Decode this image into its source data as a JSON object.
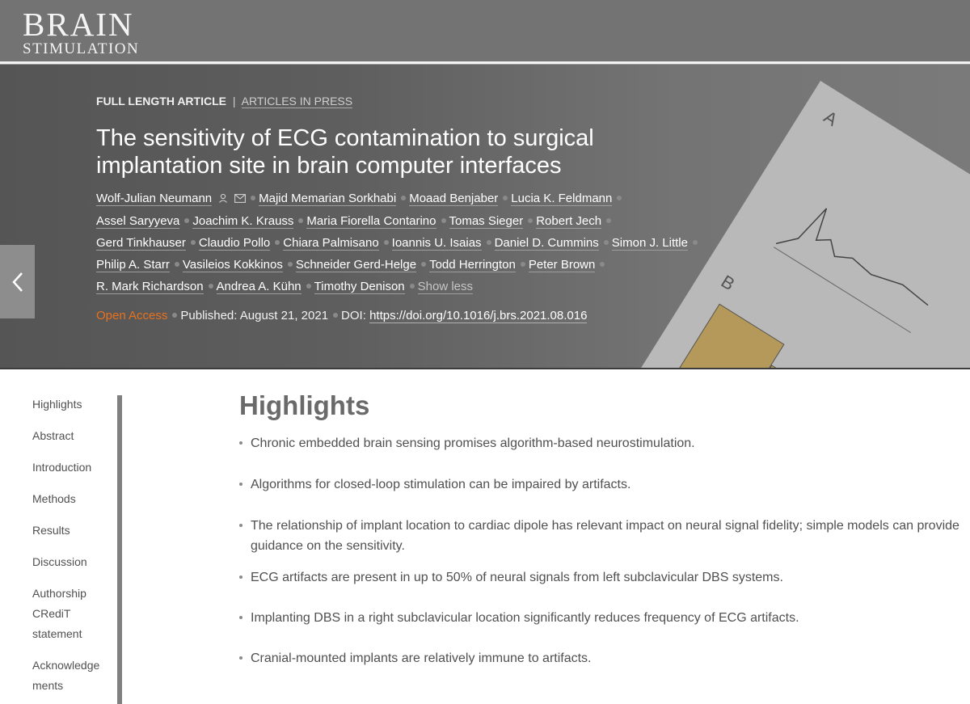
{
  "journal": {
    "logo_line1": "BRAIN",
    "logo_line2": "STIMULATION"
  },
  "article": {
    "type": "FULL LENGTH ARTICLE",
    "type_separator": "|",
    "status_link": "ARTICLES IN PRESS",
    "title": "The sensitivity of ECG contamination to surgical implantation site in brain computer interfaces",
    "authors": [
      "Wolf-Julian Neumann",
      "Majid Memarian Sorkhabi",
      "Moaad Benjaber",
      "Lucia K. Feldmann",
      "Assel Saryyeva",
      "Joachim K. Krauss",
      "Maria Fiorella Contarino",
      "Tomas Sieger",
      "Robert Jech",
      "Gerd Tinkhauser",
      "Claudio Pollo",
      "Chiara Palmisano",
      "Ioannis U. Isaias",
      "Daniel D. Cummins",
      "Simon J. Little",
      "Philip A. Starr",
      "Vasileios Kokkinos",
      "Schneider Gerd-Helge",
      "Todd Herrington",
      "Peter Brown",
      "R. Mark Richardson",
      "Andrea A. Kühn",
      "Timothy Denison"
    ],
    "show_less_label": "Show less",
    "open_access_label": "Open Access",
    "published": "Published: August 21, 2021",
    "doi_label": "DOI:",
    "doi_link": "https://doi.org/10.1016/j.brs.2021.08.016"
  },
  "toc": {
    "items": [
      "Highlights",
      "Abstract",
      "Introduction",
      "Methods",
      "Results",
      "Discussion",
      "Authorship CRediT statement",
      "Acknowledgements"
    ]
  },
  "highlights": {
    "heading": "Highlights",
    "items": [
      "Chronic embedded brain sensing promises algorithm-based neurostimulation.",
      "Algorithms for closed-loop stimulation can be impaired by artifacts.",
      "The relationship of implant location to cardiac dipole has relevant impact on neural signal fidelity; simple models can provide guidance on the sensitivity.",
      "ECG artifacts are present in up to 50% of neural signals from left subclavicular DBS systems.",
      "Implanting DBS in a right subclavicular location significantly reduces frequency of ECG artifacts.",
      "Cranial-mounted implants are relatively immune to artifacts."
    ]
  },
  "colors": {
    "open_access": "#e9711c",
    "header_bg": "#737373"
  },
  "icons": {
    "back": "chevron-left-icon",
    "person": "person-icon",
    "email": "envelope-icon"
  }
}
